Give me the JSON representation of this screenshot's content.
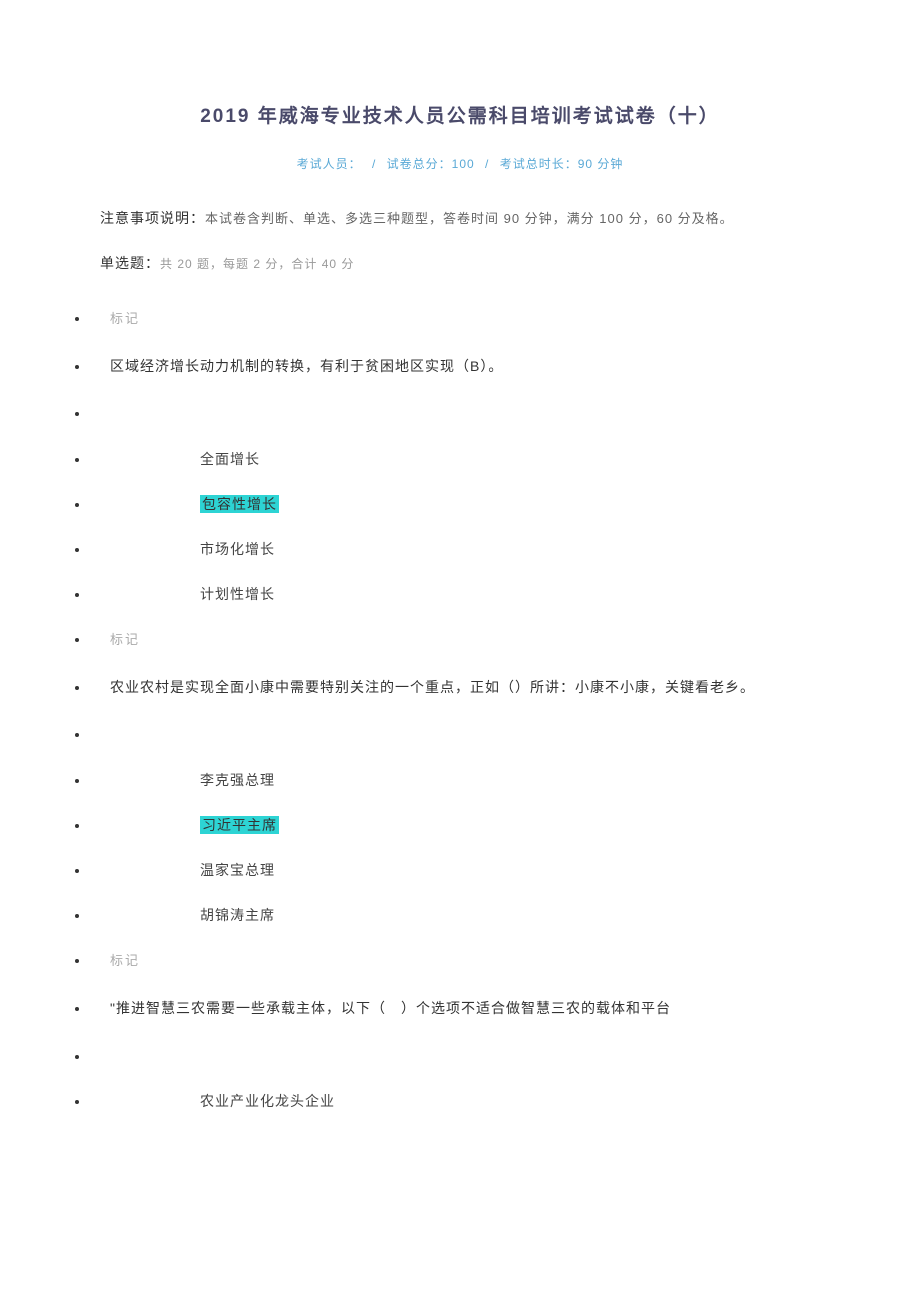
{
  "title": "2019 年威海专业技术人员公需科目培训考试试卷（十）",
  "meta": {
    "examinee_label": "考试人员：",
    "score_label": "试卷总分：",
    "score_value": "100",
    "duration_label": "考试总时长：",
    "duration_value": "90 分钟"
  },
  "notice_label": "注意事项说明：",
  "notice_text": "本试卷含判断、单选、多选三种题型，答卷时间 90 分钟，满分 100 分，60 分及格。",
  "section_label": "单选题：",
  "section_sub": "共 20 题，每题 2 分，合计 40 分",
  "mark_label": "标记",
  "questions": [
    {
      "text": "区域经济增长动力机制的转换，有利于贫困地区实现（B）。",
      "options": [
        {
          "text": "全面增长",
          "highlight": false
        },
        {
          "text": "包容性增长",
          "highlight": true
        },
        {
          "text": "市场化增长",
          "highlight": false
        },
        {
          "text": "计划性增长",
          "highlight": false
        }
      ]
    },
    {
      "text": "农业农村是实现全面小康中需要特别关注的一个重点，正如（）所讲：小康不小康，关键看老乡。",
      "options": [
        {
          "text": "李克强总理",
          "highlight": false
        },
        {
          "text": "习近平主席",
          "highlight": true
        },
        {
          "text": "温家宝总理",
          "highlight": false
        },
        {
          "text": "胡锦涛主席",
          "highlight": false
        }
      ]
    },
    {
      "text": "\"推进智慧三农需要一些承载主体，以下（　）个选项不适合做智慧三农的载体和平台",
      "options": [
        {
          "text": "农业产业化龙头企业",
          "highlight": false
        }
      ]
    }
  ]
}
